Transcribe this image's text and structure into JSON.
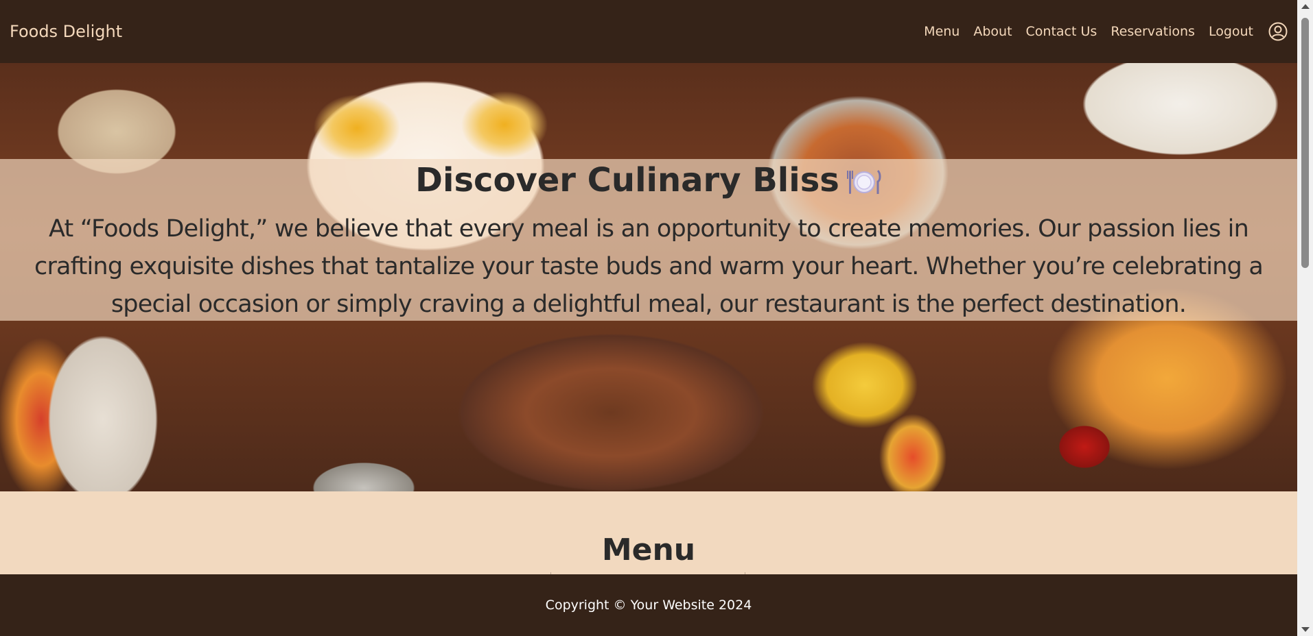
{
  "nav": {
    "brand": "Foods Delight",
    "links": [
      "Menu",
      "About",
      "Contact Us",
      "Reservations",
      "Logout"
    ],
    "user_icon": "user-circle-icon"
  },
  "hero": {
    "title": "Discover Culinary Bliss",
    "title_icon": "plate-cutlery-icon",
    "text": "At “Foods Delight,” we believe that every meal is an opportunity to create memories. Our passion lies in crafting exquisite dishes that tantalize your taste buds and warm your heart. Whether you’re celebrating a special occasion or simply craving a delightful meal, our restaurant is the perfect destination."
  },
  "menu_section": {
    "heading": "Menu"
  },
  "footer": {
    "copyright": "Copyright © Your Website 2024"
  },
  "colors": {
    "dark_brown": "#352318",
    "cream": "#f2d9bf",
    "nav_text": "#f4d8bb"
  }
}
